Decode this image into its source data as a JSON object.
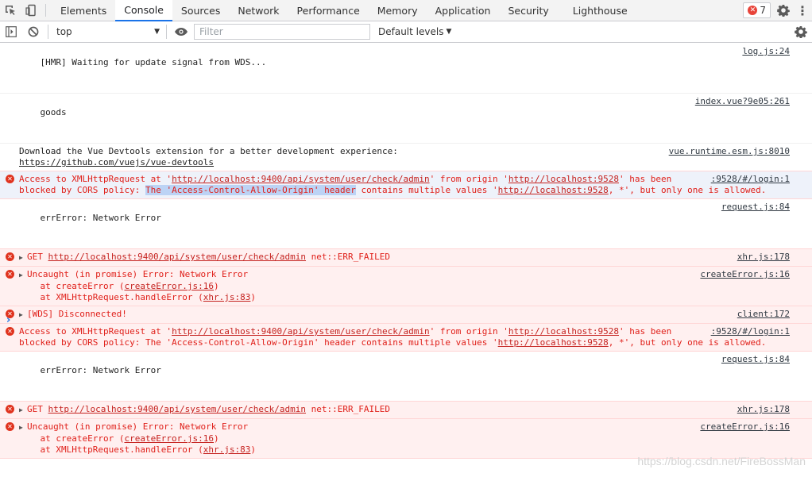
{
  "tabs": [
    "Elements",
    "Console",
    "Sources",
    "Network",
    "Performance",
    "Memory",
    "Application",
    "Security",
    "Lighthouse"
  ],
  "active_tab": "Console",
  "error_count": "7",
  "toolbar": {
    "context": "top",
    "filter_placeholder": "Filter",
    "levels": "Default levels"
  },
  "messages": {
    "m0": {
      "text": "[HMR] Waiting for update signal from WDS...",
      "src": "log.js:24"
    },
    "m1": {
      "text": "goods",
      "src": "index.vue?9e05:261"
    },
    "m2": {
      "text": "Download the Vue Devtools extension for a better development experience:",
      "link": "https://github.com/vuejs/vue-devtools",
      "src": "vue.runtime.esm.js:8010"
    },
    "m3": {
      "a": "Access to XMLHttpRequest at '",
      "url1": "http://localhost:9400/api/system/user/check/admin",
      "b": "' from origin '",
      "url2": "http://localhost:9528",
      "c": "' has been",
      "d": "blocked by CORS policy: ",
      "hl": "The 'Access-Control-Allow-Origin' header",
      "e": " contains multiple values '",
      "url3": "http://localhost:9528",
      "f": ", *', but only one is allowed.",
      "src": ":9528/#/login:1"
    },
    "m4": {
      "text": "errError: Network Error",
      "src": "request.js:84"
    },
    "m5": {
      "get": "GET ",
      "url": "http://localhost:9400/api/system/user/check/admin",
      "rest": " net::ERR_FAILED",
      "src": "xhr.js:178"
    },
    "m6": {
      "line1": "Uncaught (in promise) Error: Network Error",
      "l2a": "    at createError (",
      "l2link": "createError.js:16",
      "l2b": ")",
      "l3a": "    at XMLHttpRequest.handleError (",
      "l3link": "xhr.js:83",
      "l3b": ")",
      "src": "createError.js:16"
    },
    "m7": {
      "text": "[WDS] Disconnected!",
      "src": "client:172"
    },
    "m8": {
      "a": "Access to XMLHttpRequest at '",
      "url1": "http://localhost:9400/api/system/user/check/admin",
      "b": "' from origin '",
      "url2": "http://localhost:9528",
      "c": "' has been",
      "d": "blocked by CORS policy: The 'Access-Control-Allow-Origin' header contains multiple values '",
      "url3": "http://localhost:9528",
      "f": ", *', but only one is allowed.",
      "src": ":9528/#/login:1"
    },
    "m9": {
      "text": "errError: Network Error",
      "src": "request.js:84"
    },
    "m10": {
      "get": "GET ",
      "url": "http://localhost:9400/api/system/user/check/admin",
      "rest": " net::ERR_FAILED",
      "src": "xhr.js:178"
    },
    "m11": {
      "line1": "Uncaught (in promise) Error: Network Error",
      "l2a": "    at createError (",
      "l2link": "createError.js:16",
      "l2b": ")",
      "l3a": "    at XMLHttpRequest.handleError (",
      "l3link": "xhr.js:83",
      "l3b": ")",
      "src": "createError.js:16"
    }
  },
  "watermark": "https://blog.csdn.net/FireBossMan"
}
